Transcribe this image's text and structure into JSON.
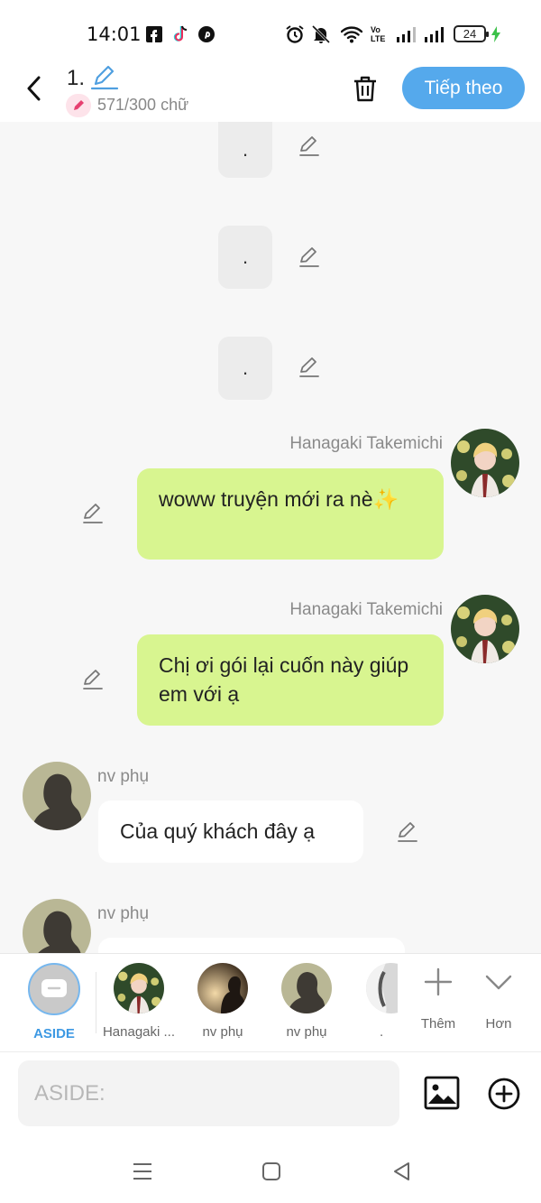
{
  "status_bar": {
    "time": "14:01",
    "battery": "24"
  },
  "header": {
    "title": "1.",
    "word_count": "571/300 chữ",
    "next_label": "Tiếp theo"
  },
  "messages": {
    "dot1": ".",
    "dot2": ".",
    "dot3": ".",
    "m1": {
      "sender": "Hanagaki Takemichi",
      "text": "woww truyện mới ra nè✨"
    },
    "m2": {
      "sender": "Hanagaki Takemichi",
      "text": "Chị ơi gói lại cuốn này giúp em với ạ"
    },
    "m3": {
      "sender": "nv phụ",
      "text": "Của quý khách đây ạ"
    },
    "m4": {
      "sender": "nv phụ"
    }
  },
  "characters": {
    "aside": "ASIDE",
    "c1": "Hanagaki ...",
    "c2": "nv phụ",
    "c3": "nv phụ",
    "c4": ".",
    "add": "Thêm",
    "more": "Hơn"
  },
  "input": {
    "placeholder": "ASIDE:"
  },
  "colors": {
    "accent": "#55a9ec",
    "bubble_green": "#d8f590",
    "aside_blue": "#3d99e3"
  }
}
